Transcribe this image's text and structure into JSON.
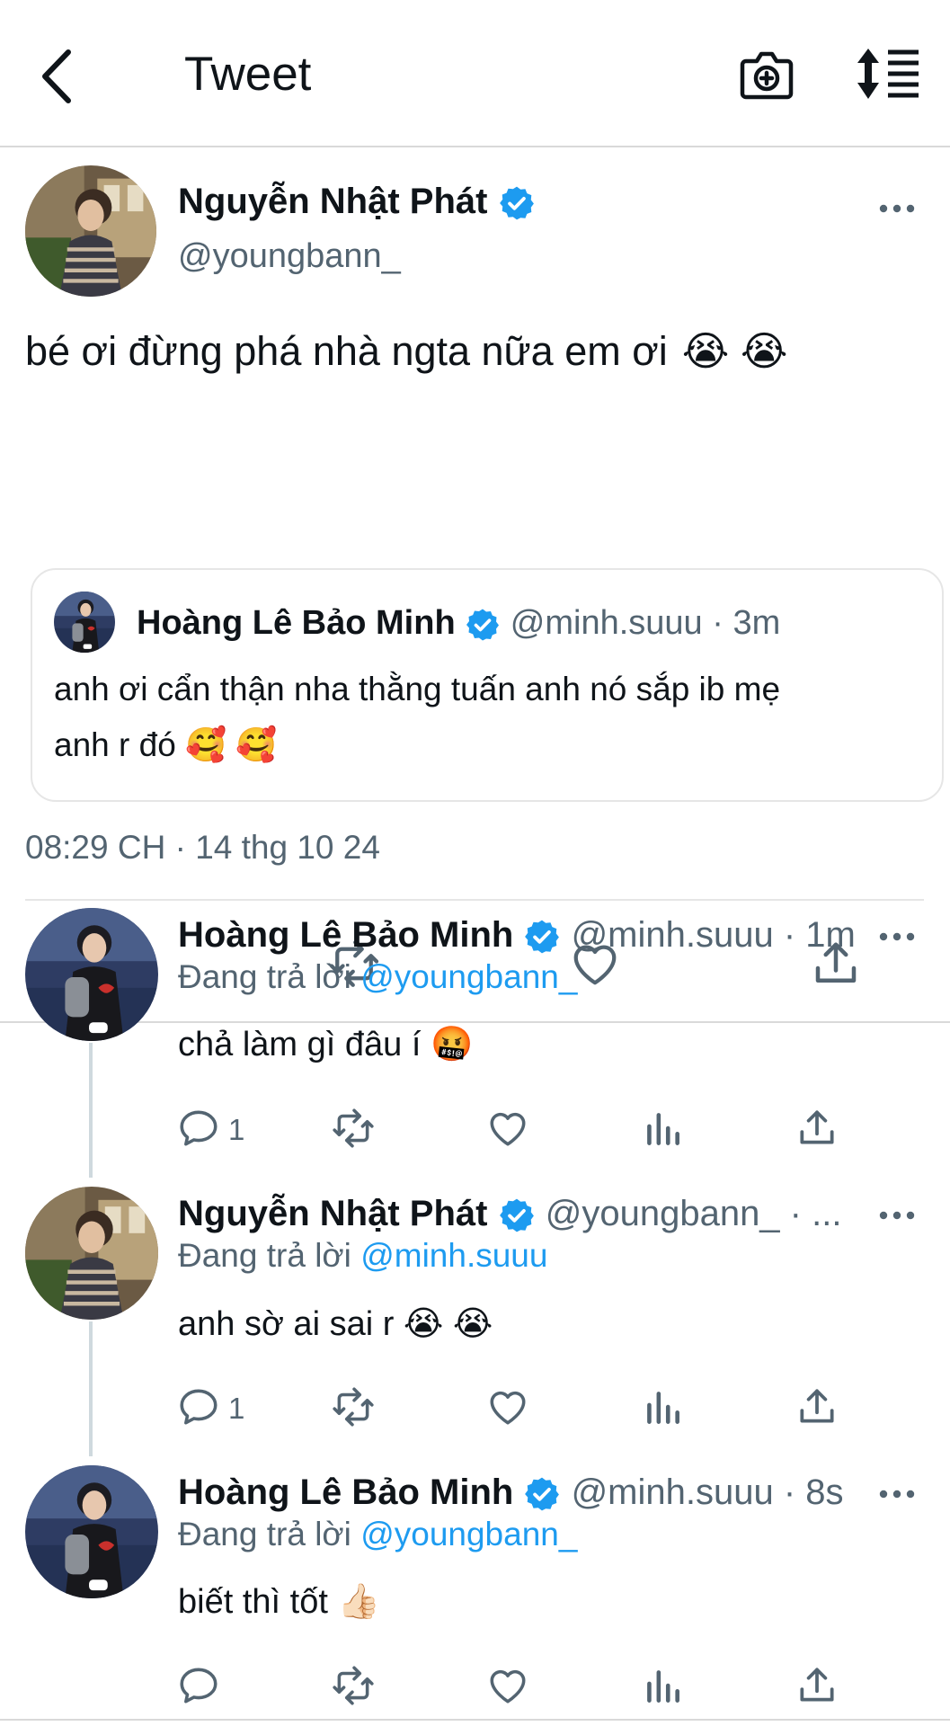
{
  "header": {
    "title": "Tweet",
    "back_icon": "chevron-left-icon",
    "camera_icon": "camera-plus-icon",
    "sort_icon": "sort-icon"
  },
  "colors": {
    "accent": "#1d9bf0",
    "text": "#0f1419",
    "secondary": "#536471",
    "border": "#e6e6e6"
  },
  "main_tweet": {
    "name": "Nguyễn Nhật Phát",
    "handle": "@youngbann_",
    "text": "bé ơi đừng phá nhà ngta nữa em ơi",
    "emojis": [
      "😭",
      "😭"
    ],
    "timestamp": "08:29 CH · 14 thg 10 24",
    "quote": {
      "name": "Hoàng Lê Bảo Minh",
      "handle_time": "@minh.suuu · 3m",
      "text_line1": "anh ơi cẩn thận nha thằng tuấn anh nó sắp ib mẹ",
      "text_line2": "anh r đó",
      "emojis": [
        "🥰",
        "🥰"
      ]
    }
  },
  "replies": [
    {
      "name": "Hoàng Lê Bảo Minh",
      "handle_time": "@minh.suuu · 1m",
      "replying_label": "Đang trả lời",
      "replying_to": "@youngbann_",
      "text": "chả làm gì đâu í",
      "emoji": "🤬",
      "reply_count": "1"
    },
    {
      "name": "Nguyễn Nhật Phát",
      "handle_time": "@youngbann_ · ...",
      "replying_label": "Đang trả lời",
      "replying_to": "@minh.suuu",
      "text": "anh sờ ai sai r",
      "emoji": "😭 😭",
      "reply_count": "1"
    },
    {
      "name": "Hoàng Lê Bảo Minh",
      "handle_time": "@minh.suuu · 8s",
      "replying_label": "Đang trả lời",
      "replying_to": "@youngbann_",
      "text": "biết thì tốt",
      "emoji": "👍🏻",
      "reply_count": ""
    }
  ]
}
